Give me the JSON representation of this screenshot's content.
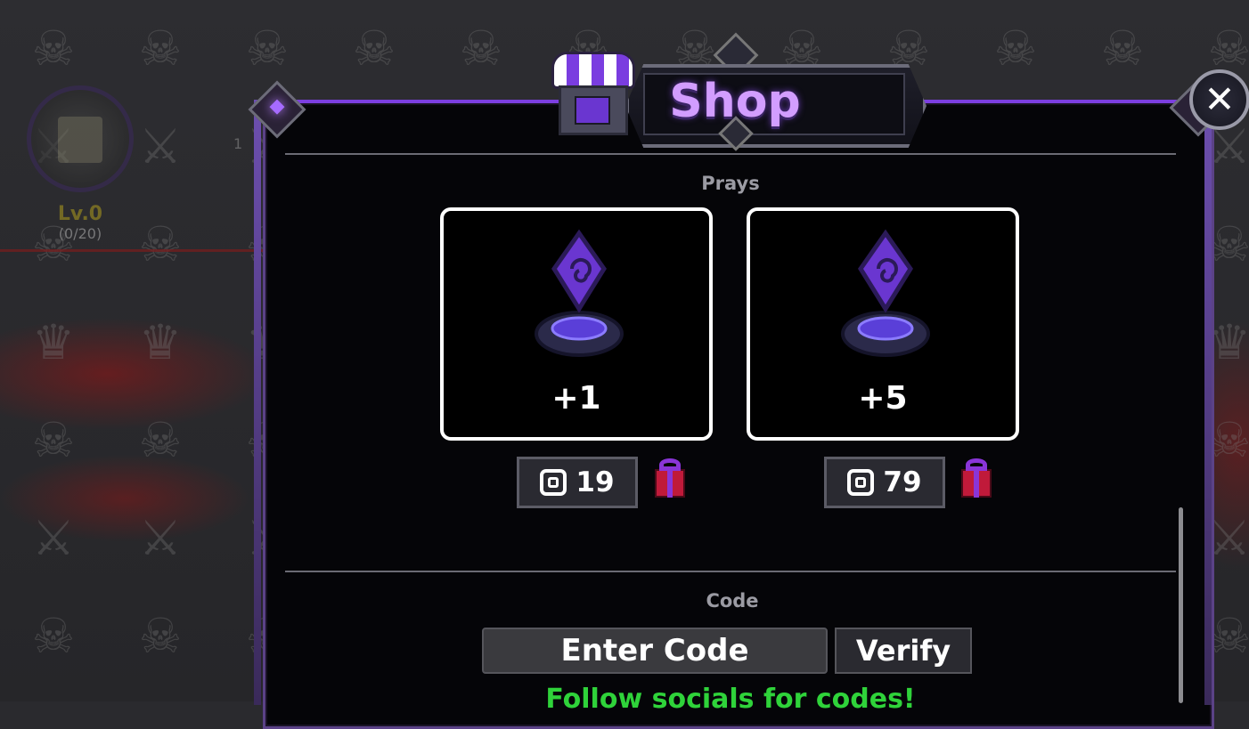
{
  "player": {
    "level": "Lv.0",
    "xp": "(0/20)",
    "side_number": "1"
  },
  "shop": {
    "title": "Shop",
    "close_label": "✕",
    "prays_section_title": "Prays",
    "items": [
      {
        "amount": "+1",
        "price": "19",
        "currency_icon": "robux-icon",
        "gift_icon": "gift-icon"
      },
      {
        "amount": "+5",
        "price": "79",
        "currency_icon": "robux-icon",
        "gift_icon": "gift-icon"
      }
    ],
    "code_section_title": "Code",
    "code_input_placeholder": "Enter Code",
    "verify_label": "Verify",
    "follow_text": "Follow socials for codes!"
  },
  "colors": {
    "accent": "#d29dff",
    "panel_border": "#7c3fe0",
    "follow_text": "#2fd33a"
  }
}
